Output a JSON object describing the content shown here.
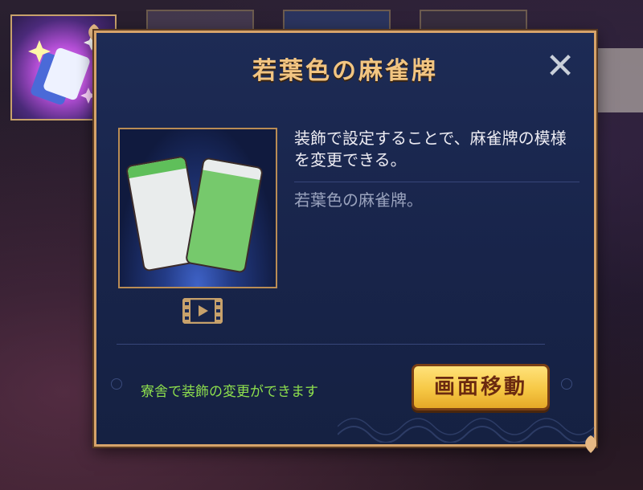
{
  "dialog": {
    "title": "若葉色の麻雀牌",
    "close_glyph": "✕",
    "description": "装飾で設定することで、麻雀牌の模様を変更できる。",
    "flavor": "若葉色の麻雀牌。",
    "hint": "寮舎で装飾の変更ができます",
    "move_button": "画面移動"
  },
  "icons": {
    "close": "close-icon",
    "video": "video-play-icon",
    "item": "sparkle-tile-icon"
  },
  "colors": {
    "title": "#f2c582",
    "hint": "#8ee04d",
    "button": "#f6c845",
    "frame": "#d6a36a",
    "panel": "#1d2b55"
  }
}
